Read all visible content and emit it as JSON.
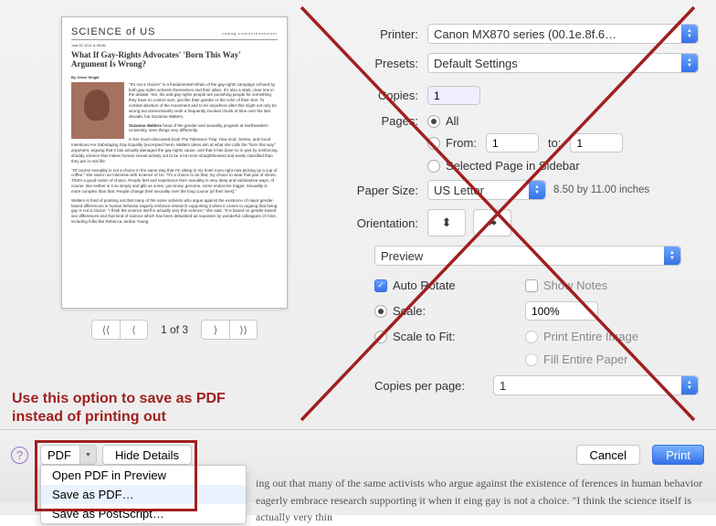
{
  "annotation": "Use this option to save as PDF instead of printing out",
  "pager": {
    "count": "1 of 3"
  },
  "article": {
    "site": "SCIENCE of US",
    "url_line": "nymag.com/scienceofus/",
    "date": "June 16, 2014  11:38 AM",
    "headline": "What If Gay-Rights Advocates' 'Born This Way' Argument Is Wrong?",
    "byline": "By Jesse Singal",
    "body1": "\"It's not a choice!\" is a fundamental refrain of the gay-rights campaign echoed by both gay-rights activists themselves and their allies. It's also a stark, clear line in the debate: Yes, the anti-gay-rights people are punishing people for something they have no control over, just like their gender or the color of their skin. To combat abortion of the movement and to be anywhere after this might not only be wrong but unnecessarily cede a frequently invoked chunk of time over the last decade, but Suzanna Walters,",
    "credit": "Suzanna Walters",
    "body2": "head of the gender and sexuality program at Northeastern University, sees things very differently.",
    "body3": "In her much-discussed book The Tolerance Trap: How God, Genes, and Good Intentions Are Sabotaging Gay Equality (excerpted here), Walters takes aim at what she calls the \"born this way\" argument, arguing that it has actually damaged the gay-rights cause, and that it has done so in part by reinforcing shoddy science that makes human sexual activity out to be a lot more straightforward and easily classified than they are in real life.",
    "body4": "\"Of course sexuality is not a choice in the same way that I'm sitting in my hotel room right now picking up a cup of coffee,\" she said in an interview with Science of Us. \"It's a choice to do that, my choice to wear that pair of shoes. That's a good notion of choice. People feel and experience their sexuality in very deep and substantive ways, of course. But neither is it as simply and glib as some, you know, genome, some endocrine trigger. Sexuality is more complex than that. People change their sexuality over the long course [of their lives].\"",
    "body5": "Walters is fond of pointing out that many of the same activists who argue against the existence of major gender-based differences in human behavior eagerly embrace research supporting it when it comes to arguing that being gay is not a choice. \"I think the science itself is actually very thin science,\" she said. \"It is based on gender-based sex differences and that kind of science which has been debunked ad nauseam by wonderful colleagues of mine, including folks like Rebecca Jordan-Young."
  },
  "print": {
    "printer_label": "Printer:",
    "printer_value": "Canon MX870 series (00.1e.8f.6…",
    "presets_label": "Presets:",
    "presets_value": "Default Settings",
    "copies_label": "Copies:",
    "copies_value": "1",
    "pages_label": "Pages:",
    "pages_all": "All",
    "pages_from": "From:",
    "pages_from_v": "1",
    "pages_to": "to:",
    "pages_to_v": "1",
    "pages_sel": "Selected Page in Sidebar",
    "paper_label": "Paper Size:",
    "paper_value": "US Letter",
    "paper_dims": "8.50 by 11.00 inches",
    "orient_label": "Orientation:",
    "app_menu": "Preview",
    "autorotate": "Auto Rotate",
    "shownotes": "Show Notes",
    "scale": "Scale:",
    "scale_v": "100%",
    "scalefit": "Scale to Fit:",
    "fit_entire": "Print Entire Image",
    "fit_fill": "Fill Entire Paper",
    "cpp_label": "Copies per page:",
    "cpp_v": "1"
  },
  "buttons": {
    "pdf": "PDF",
    "hide": "Hide Details",
    "cancel": "Cancel",
    "print": "Print"
  },
  "menu": {
    "open": "Open PDF in Preview",
    "save": "Save as PDF…",
    "post": "Save as PostScript…"
  },
  "bg_text": "ing out that many of the same activists who argue against the existence of ferences in human behavior eagerly embrace research supporting it when it eing gay is not a choice. \"I think the science itself is actually very thin"
}
